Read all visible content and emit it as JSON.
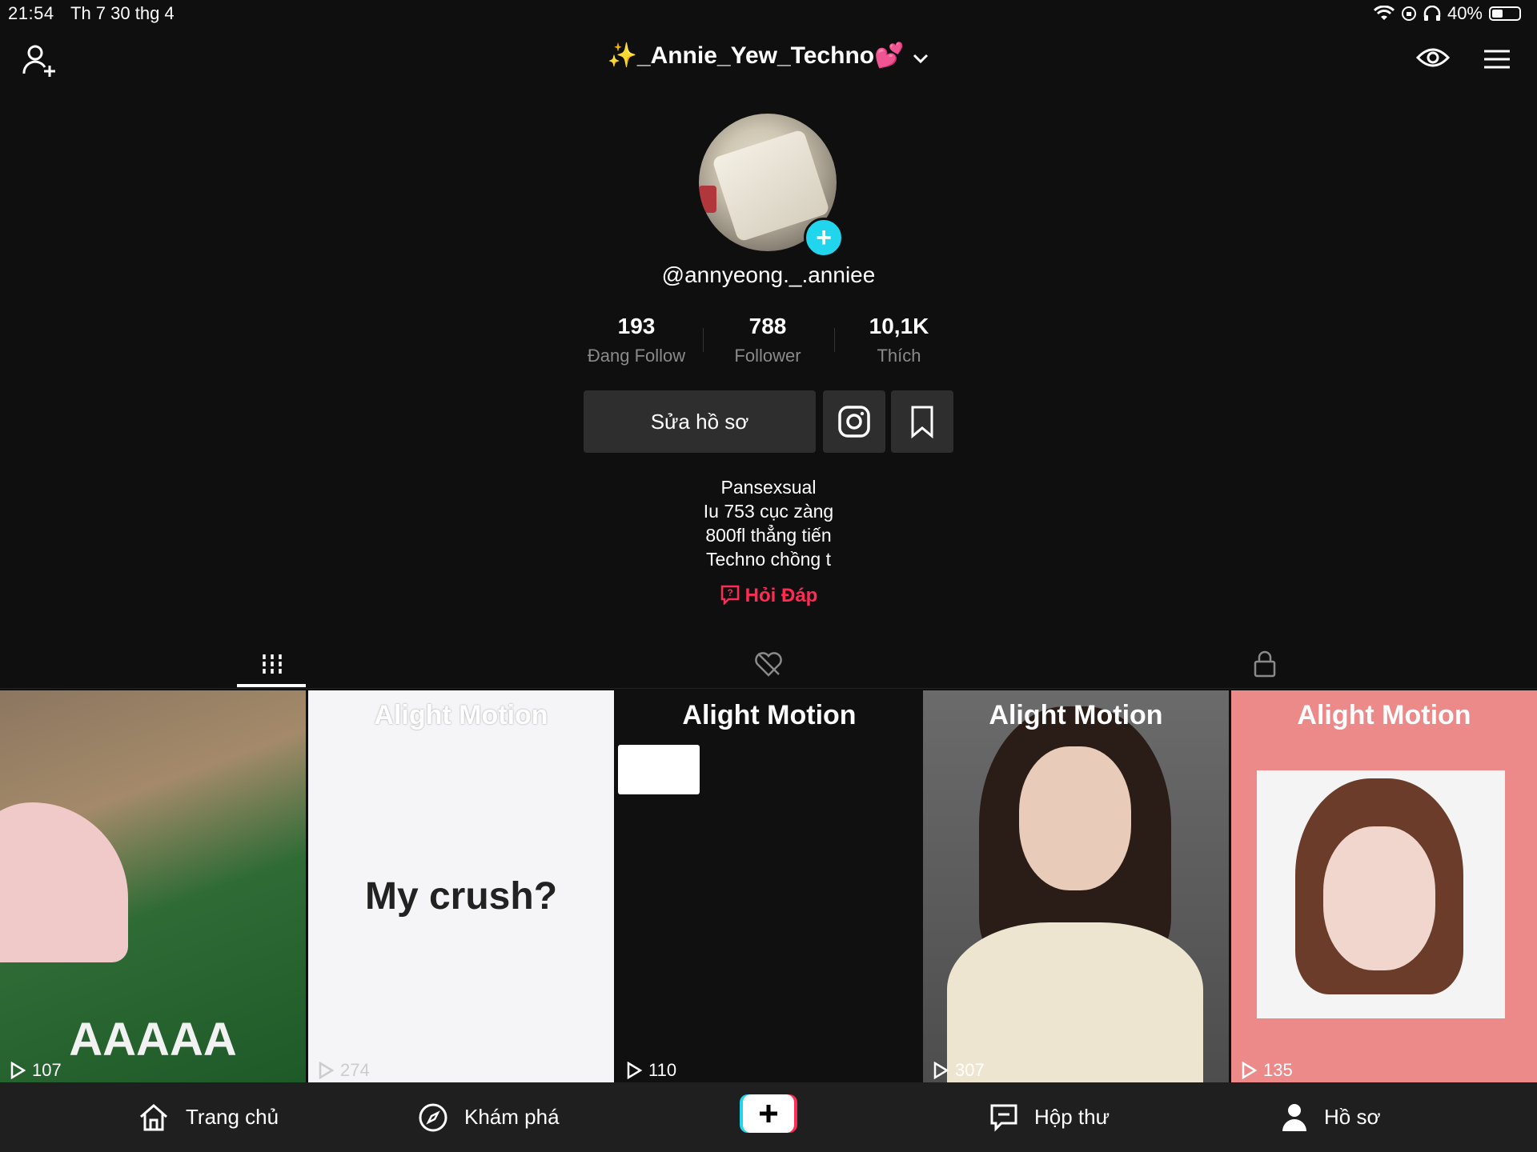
{
  "status_bar": {
    "time": "21:54",
    "date": "Th 7 30 thg 4",
    "battery": "40%",
    "battery_level": 0.4
  },
  "header": {
    "title": "✨_Annie_Yew_Techno💕"
  },
  "profile": {
    "username": "@annyeong._.anniee",
    "stats": [
      {
        "value": "193",
        "label": "Đang Follow"
      },
      {
        "value": "788",
        "label": "Follower"
      },
      {
        "value": "10,1K",
        "label": "Thích"
      }
    ],
    "edit_button": "Sửa hồ sơ",
    "bio": [
      "Pansexsual",
      "Iu 753 cục zàng",
      "800fl thẳng tiến",
      "Techno chồng t"
    ],
    "qa_label": "Hỏi Đáp"
  },
  "tabs": [
    "videos-grid-icon",
    "liked-hidden-icon",
    "lock-icon"
  ],
  "videos": [
    {
      "watermark": "",
      "caption": "AAAAA",
      "views": "107"
    },
    {
      "watermark": "Alight Motion",
      "caption": "My crush?",
      "views": "274"
    },
    {
      "watermark": "Alight Motion",
      "caption": "",
      "views": "110"
    },
    {
      "watermark": "Alight Motion",
      "caption": "",
      "views": "307"
    },
    {
      "watermark": "Alight Motion",
      "caption": "",
      "views": "135"
    }
  ],
  "bottom_nav": [
    {
      "label": "Trang chủ",
      "icon": "home-icon"
    },
    {
      "label": "Khám phá",
      "icon": "compass-icon"
    },
    {
      "label": "Hộp thư",
      "icon": "inbox-icon"
    },
    {
      "label": "Hồ sơ",
      "icon": "profile-icon"
    }
  ],
  "colors": {
    "accent": "#fe2c55",
    "cyan": "#20d5ec",
    "background": "#0f0f0f"
  }
}
